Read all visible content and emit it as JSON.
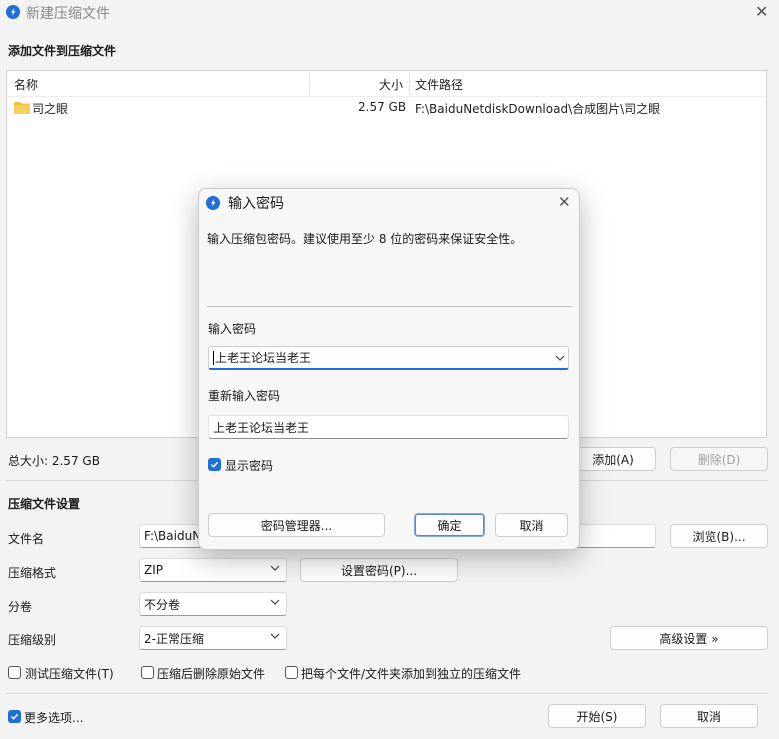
{
  "window": {
    "title": "新建压缩文件"
  },
  "add_files": {
    "heading": "添加文件到压缩文件",
    "columns": {
      "name": "名称",
      "size": "大小",
      "path": "文件路径"
    },
    "rows": [
      {
        "name": "司之眼",
        "size": "2.57 GB",
        "path": "F:\\BaiduNetdiskDownload\\合成图片\\司之眼"
      }
    ],
    "total_size": "总大小: 2.57 GB",
    "add_label": "添加(A)",
    "delete_label": "删除(D)"
  },
  "settings": {
    "heading": "压缩文件设置",
    "filename_label": "文件名",
    "filename_value": "F:\\BaiduN",
    "browse_label": "浏览(B)...",
    "format_label": "压缩格式",
    "format_value": "ZIP",
    "set_password_label": "设置密码(P)...",
    "volume_label": "分卷",
    "volume_value": "不分卷",
    "level_label": "压缩级别",
    "level_value": "2-正常压缩",
    "advanced_label": "高级设置 »",
    "test_label": "测试压缩文件(T)",
    "delete_after_label": "压缩后删除原始文件",
    "each_file_label": "把每个文件/文件夹添加到独立的压缩文件"
  },
  "footer": {
    "more_options_label": "更多选项...",
    "start_label": "开始(S)",
    "cancel_label": "取消"
  },
  "dialog": {
    "title": "输入密码",
    "description": "输入压缩包密码。建议使用至少 8 位的密码来保证安全性。",
    "password_label": "输入密码",
    "password_value": "上老王论坛当老王",
    "confirm_label": "重新输入密码",
    "confirm_value": "上老王论坛当老王",
    "show_password_label": "显示密码",
    "show_password_checked": true,
    "manager_label": "密码管理器...",
    "ok_label": "确定",
    "cancel_label": "取消"
  },
  "colors": {
    "accent": "#1f6fd6",
    "folder": "#f3c041"
  }
}
